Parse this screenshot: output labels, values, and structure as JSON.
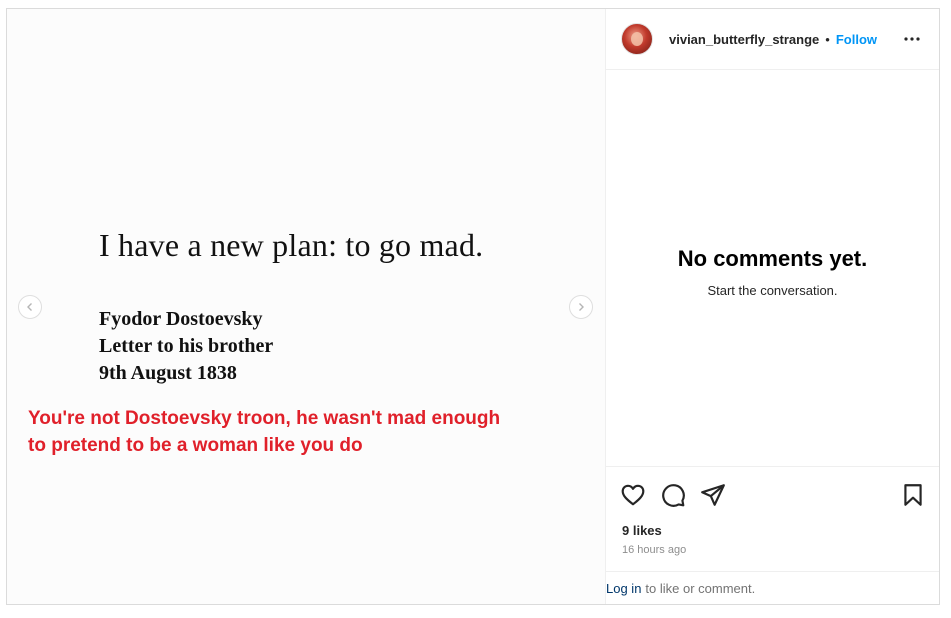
{
  "post": {
    "quote": "I have a new plan: to go mad.",
    "attribution": [
      "Fyodor Dostoevsky",
      "Letter to his brother",
      "9th August 1838"
    ],
    "overlay_text_line1": "You're not Dostoevsky troon, he wasn't mad enough",
    "overlay_text_line2": "to pretend to be a woman like you do"
  },
  "header": {
    "username": "vivian_butterfly_strange",
    "separator": "•",
    "follow_label": "Follow"
  },
  "comments": {
    "empty_title": "No comments yet.",
    "empty_subtitle": "Start the conversation."
  },
  "engagement": {
    "likes": "9 likes",
    "timestamp": "16 hours ago"
  },
  "footer": {
    "login_link": "Log in",
    "login_text": "to like or comment."
  },
  "icons": [
    "chevron-left-icon",
    "chevron-right-icon",
    "more-icon",
    "heart-icon",
    "comment-icon",
    "share-icon",
    "bookmark-icon"
  ],
  "colors": {
    "follow": "#0095f6",
    "overlay_text": "#e0202a",
    "link": "#00376b",
    "muted": "#8e8e8e"
  }
}
